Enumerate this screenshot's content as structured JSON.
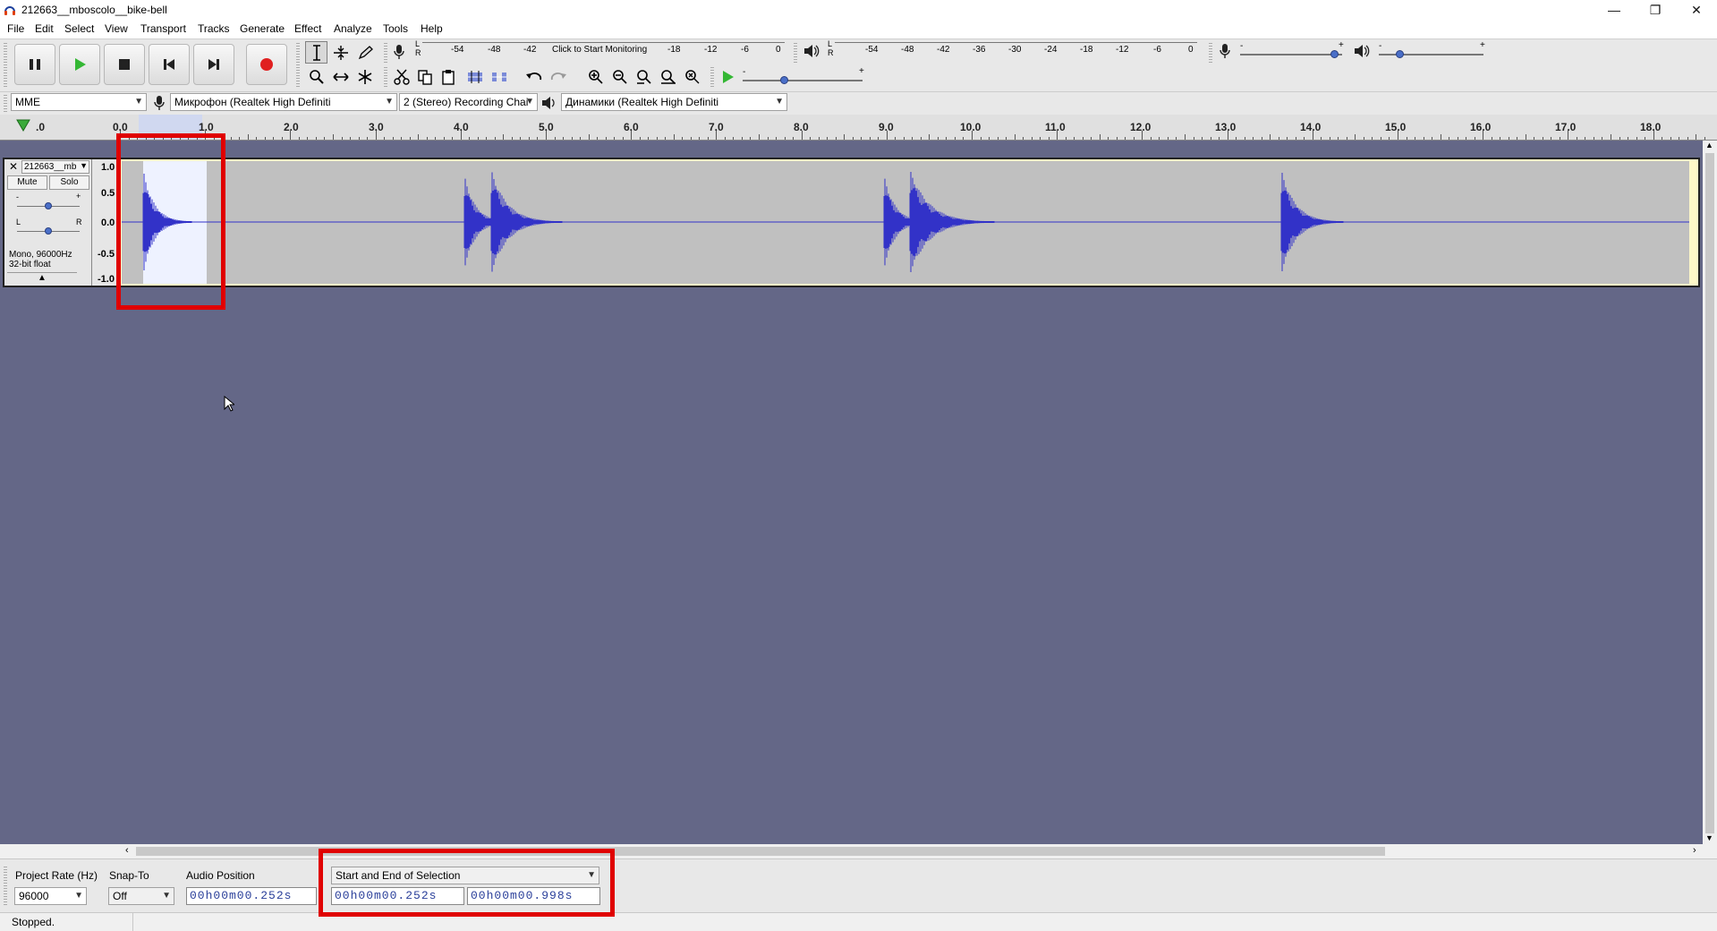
{
  "window": {
    "title": "212663__mboscolo__bike-bell",
    "minimize": "—",
    "restore": "❐",
    "close": "✕"
  },
  "menu": [
    "File",
    "Edit",
    "Select",
    "View",
    "Transport",
    "Tracks",
    "Generate",
    "Effect",
    "Analyze",
    "Tools",
    "Help"
  ],
  "record_meter": {
    "icon": "microphone-icon",
    "channels": [
      "L",
      "R"
    ],
    "scale": [
      "-54",
      "-48",
      "-42",
      "-18",
      "-12",
      "-6",
      "0"
    ],
    "prompt": "Click to Start Monitoring"
  },
  "play_meter": {
    "icon": "speaker-icon",
    "channels": [
      "L",
      "R"
    ],
    "scale": [
      "-54",
      "-48",
      "-42",
      "-36",
      "-30",
      "-24",
      "-18",
      "-12",
      "-6",
      "0"
    ]
  },
  "mixer": {
    "record_volume": 0.95,
    "play_volume": 0.2,
    "minus": "-",
    "plus": "+"
  },
  "device_toolbar": {
    "host": "MME",
    "recording_device": "Микрофон (Realtek High Definiti",
    "channels": "2 (Stereo) Recording Chai",
    "playback_device": "Динамики (Realtek High Definiti"
  },
  "ruler": {
    "labels": [
      ".0",
      "0.0",
      "1.0",
      "2.0",
      "3.0",
      "4.0",
      "5.0",
      "6.0",
      "7.0",
      "8.0",
      "9.0",
      "10.0",
      "11.0",
      "12.0",
      "13.0",
      "14.0",
      "15.0",
      "16.0",
      "17.0",
      "18.0"
    ]
  },
  "track": {
    "name": "212663__mb",
    "mute": "Mute",
    "solo": "Solo",
    "gain_minus": "-",
    "gain_plus": "+",
    "pan_left": "L",
    "pan_right": "R",
    "info_line1": "Mono, 96000Hz",
    "info_line2": "32-bit float",
    "scale": [
      "1.0",
      "0.5",
      "0.0",
      "-0.5",
      "-1.0"
    ],
    "colors": {
      "waveform": "#3232c8",
      "background": "#c0c0c0",
      "selection": "#eef2ff"
    }
  },
  "selection_toolbar": {
    "project_rate_label": "Project Rate (Hz)",
    "project_rate": "96000",
    "snap_to_label": "Snap-To",
    "snap_to": "Off",
    "audio_position_label": "Audio Position",
    "audio_position": "00h00m00.252s",
    "selection_mode": "Start and End of Selection",
    "selection_start": "00h00m00.252s",
    "selection_end": "00h00m00.998s"
  },
  "status": "Stopped."
}
